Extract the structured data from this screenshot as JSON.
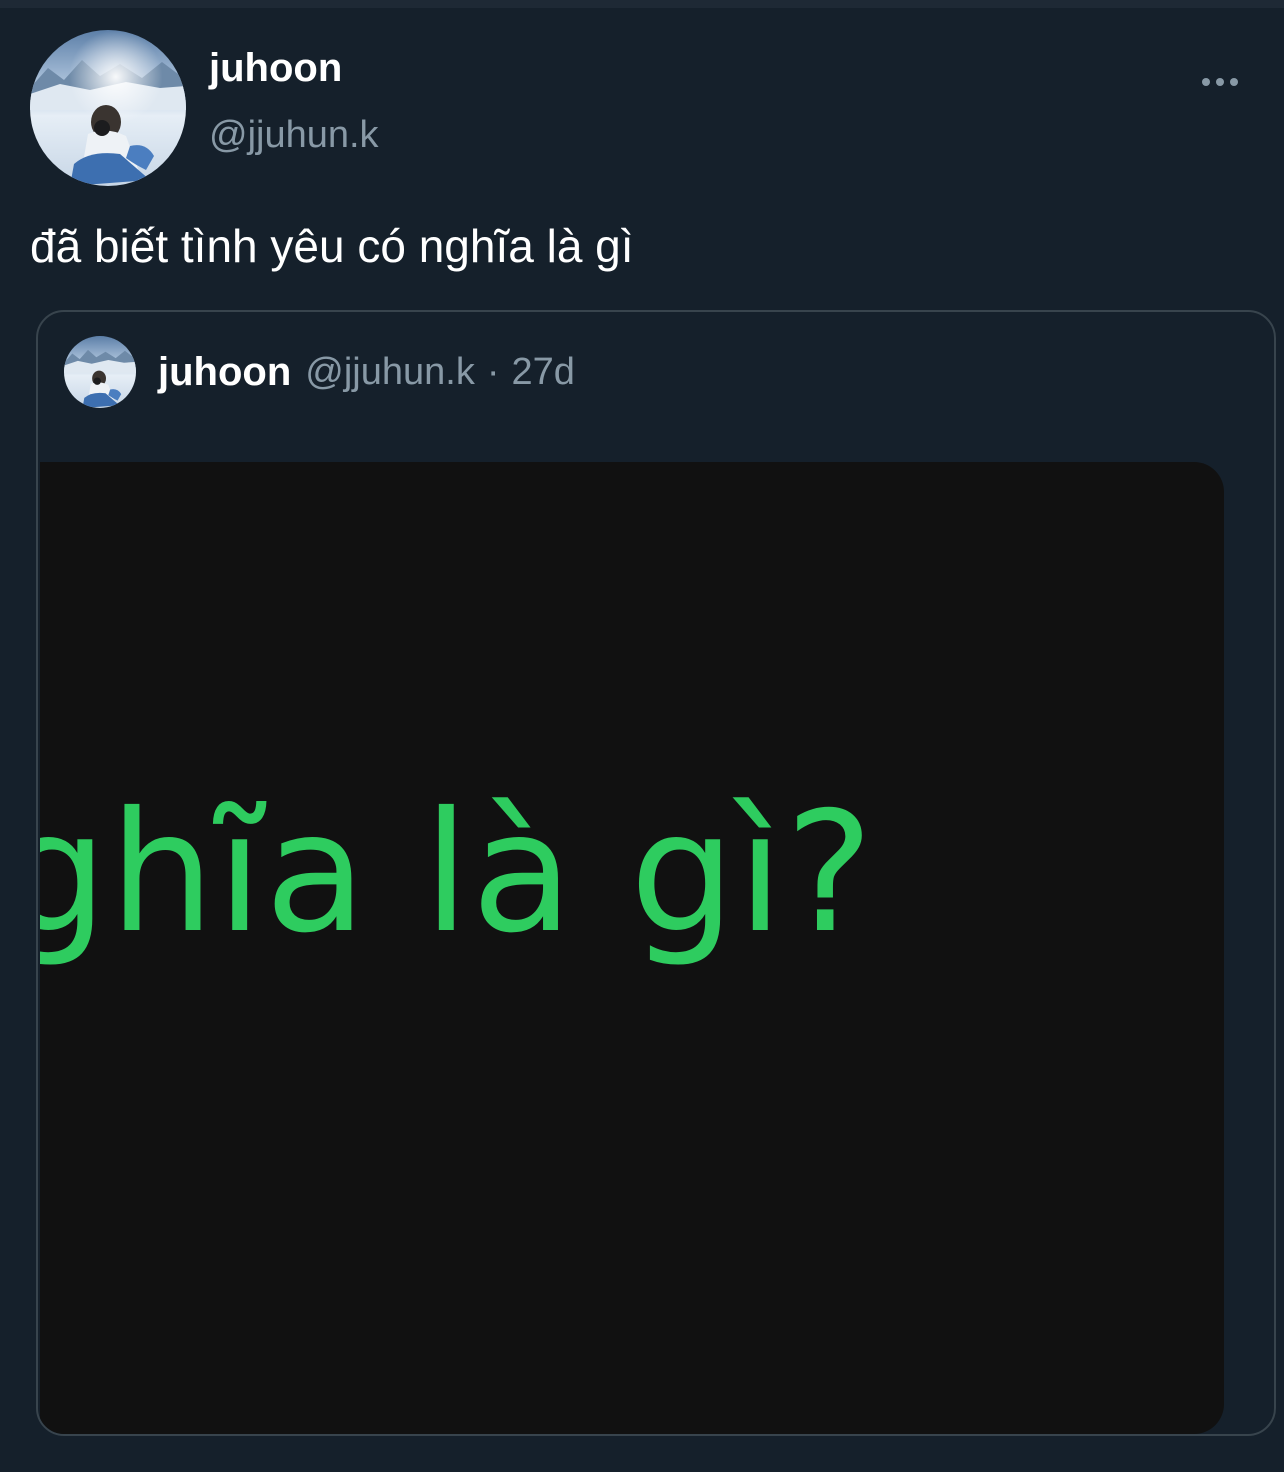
{
  "tweet": {
    "author": {
      "name": "juhoon",
      "handle": "@jjuhun.k",
      "avatar": "snowy-mountain-selfie-avatar"
    },
    "more_icon": "more-horizontal-icon",
    "text": "đã biết tình yêu có nghĩa là gì",
    "quote": {
      "author": {
        "name": "juhoon",
        "handle": "@jjuhun.k",
        "avatar": "snowy-mountain-selfie-avatar"
      },
      "separator": "·",
      "time": "27d",
      "media": {
        "text": "ghĩa là gì?",
        "text_color": "#2ecc5f",
        "background": "#111111"
      }
    }
  },
  "colors": {
    "background": "#15202b",
    "primary_text": "#ffffff",
    "secondary_text": "#8899a6",
    "border": "#38444d"
  }
}
